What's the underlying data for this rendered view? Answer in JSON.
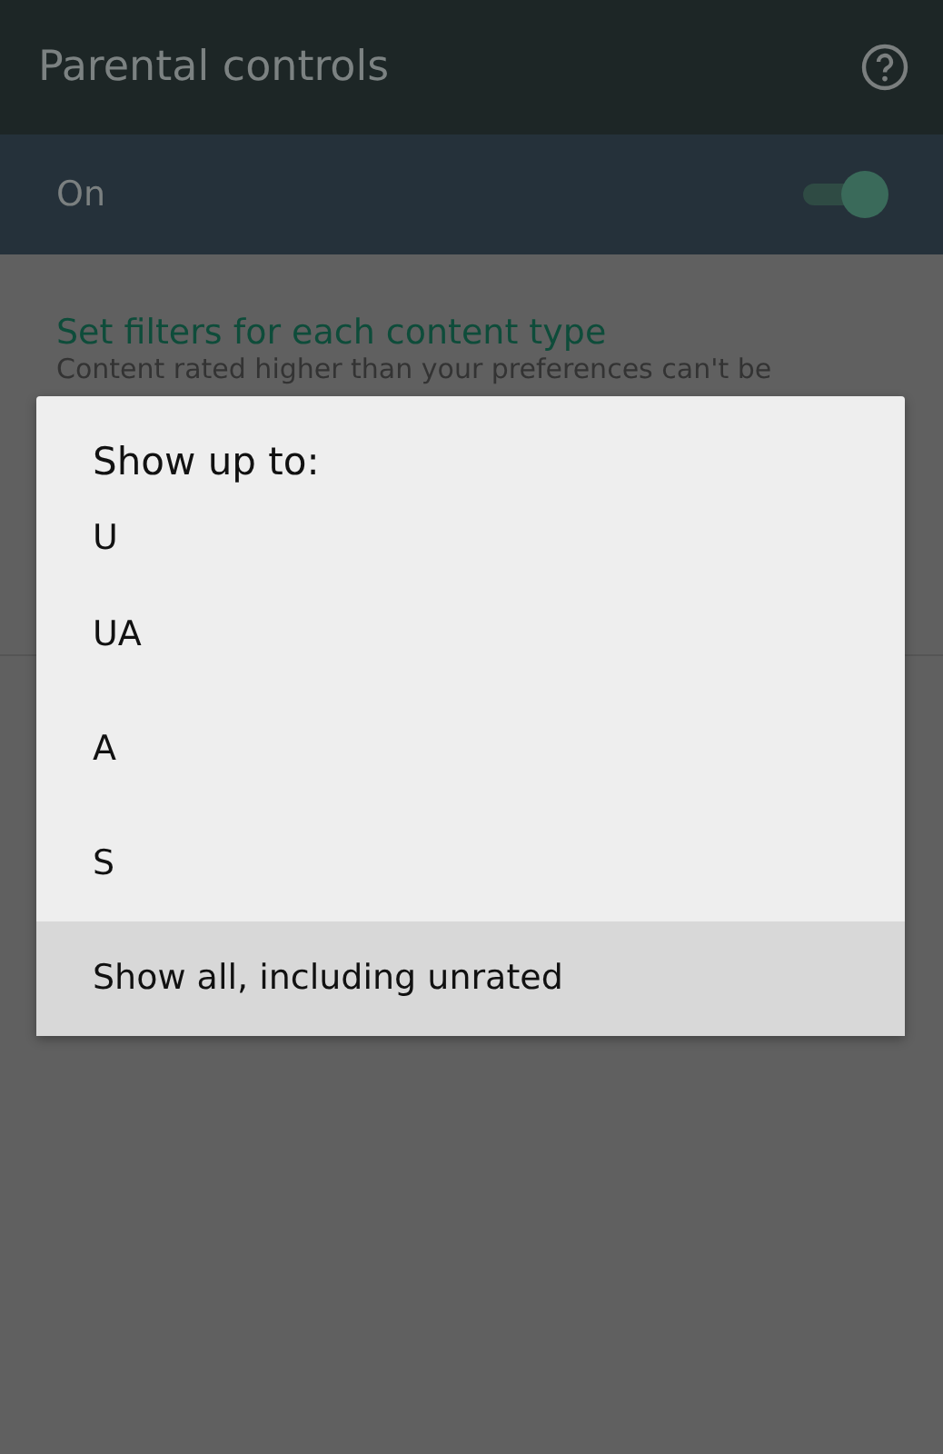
{
  "app_bar": {
    "title": "Parental controls"
  },
  "master_switch": {
    "label": "On",
    "on": true
  },
  "section": {
    "title": "Set filters for each content type",
    "description": "Content rated higher than your preferences can't be"
  },
  "dialog": {
    "title": "Show up to:",
    "options": [
      {
        "label": "U",
        "selected": false
      },
      {
        "label": "UA",
        "selected": false
      },
      {
        "label": "A",
        "selected": false
      },
      {
        "label": "S",
        "selected": false
      },
      {
        "label": "Show all, including unrated",
        "selected": true
      }
    ]
  }
}
